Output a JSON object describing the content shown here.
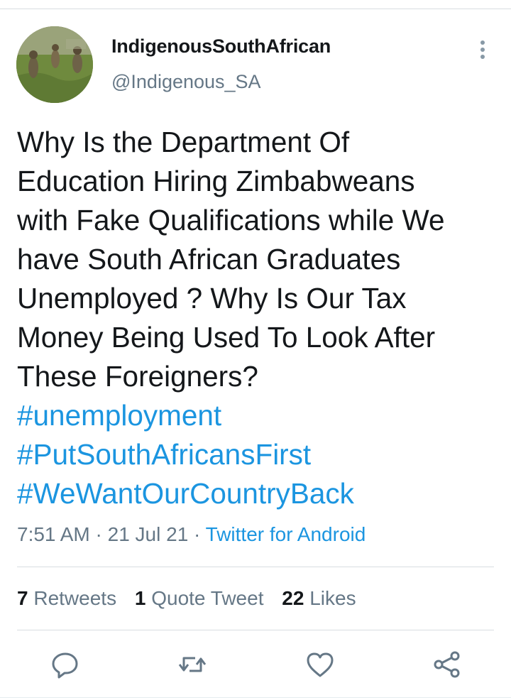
{
  "tweet": {
    "author": {
      "display_name": "IndigenousSouthAfrican",
      "handle": "@Indigenous_SA"
    },
    "text_lines": [
      "Why Is the Department Of",
      "Education Hiring Zimbabweans",
      "with Fake Qualifications while We",
      "have South African Graduates",
      "Unemployed ? Why Is Our Tax",
      "Money Being Used To Look After",
      "These Foreigners?"
    ],
    "hashtags": [
      "#unemployment",
      "#PutSouthAfricansFirst",
      "#WeWantOurCountryBack"
    ],
    "meta": {
      "time": "7:51 AM",
      "separator": "·",
      "date": "21 Jul 21",
      "source": "Twitter for Android"
    },
    "stats": {
      "retweets": {
        "count": "7",
        "label": "Retweets"
      },
      "quotes": {
        "count": "1",
        "label": "Quote Tweet"
      },
      "likes": {
        "count": "22",
        "label": "Likes"
      }
    },
    "actions": [
      "reply-icon",
      "retweet-icon",
      "like-icon",
      "share-icon"
    ],
    "colors": {
      "link": "#1b95e0",
      "text": "#14171a",
      "secondary": "#657786",
      "divider": "#d8dde1"
    }
  }
}
